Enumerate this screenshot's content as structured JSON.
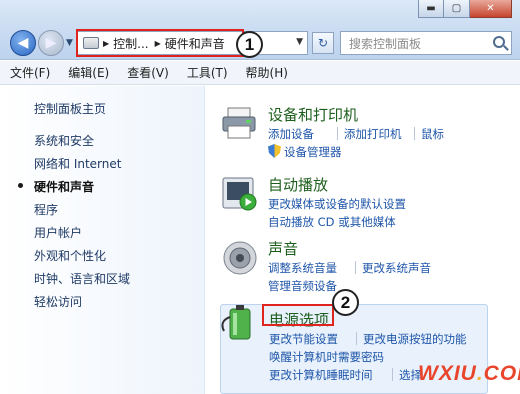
{
  "address": {
    "segments": [
      "控制...",
      "硬件和声音"
    ]
  },
  "search": {
    "placeholder": "搜索控制面板"
  },
  "menu": [
    "文件(F)",
    "编辑(E)",
    "查看(V)",
    "工具(T)",
    "帮助(H)"
  ],
  "sidebar": {
    "items": [
      {
        "label": "控制面板主页",
        "active": false
      },
      {
        "label": "系统和安全",
        "active": false
      },
      {
        "label": "网络和 Internet",
        "active": false
      },
      {
        "label": "硬件和声音",
        "active": true
      },
      {
        "label": "程序",
        "active": false
      },
      {
        "label": "用户帐户",
        "active": false
      },
      {
        "label": "外观和个性化",
        "active": false
      },
      {
        "label": "时钟、语言和区域",
        "active": false
      },
      {
        "label": "轻松访问",
        "active": false
      }
    ]
  },
  "categories": {
    "devices": {
      "title": "设备和打印机",
      "icon": "printer-icon",
      "links": [
        "添加设备",
        "添加打印机",
        "鼠标",
        "设备管理器"
      ]
    },
    "autoplay": {
      "title": "自动播放",
      "icon": "autoplay-icon",
      "links": [
        "更改媒体或设备的默认设置",
        "自动播放 CD 或其他媒体"
      ]
    },
    "sound": {
      "title": "声音",
      "icon": "speaker-icon",
      "links": [
        "调整系统音量",
        "更改系统声音",
        "管理音频设备"
      ]
    },
    "power": {
      "title": "电源选项",
      "icon": "battery-icon",
      "links": [
        "更改节能设置",
        "更改电源按钮的功能",
        "唤醒计算机时需要密码",
        "更改计算机睡眠时间",
        "选择"
      ]
    }
  },
  "callouts": {
    "one": "1",
    "two": "2"
  },
  "watermark": {
    "text_a": "WXIU",
    "dot": ".",
    "text_b": "COM"
  },
  "colors": {
    "highlight": "#e0231d",
    "link": "#1f56a9",
    "category_title": "#1e5f1e"
  }
}
